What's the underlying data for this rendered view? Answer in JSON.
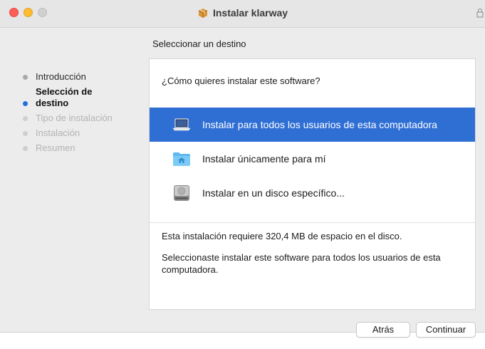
{
  "window": {
    "title": "Instalar klarway"
  },
  "step_header": "Seleccionar un destino",
  "sidebar": {
    "steps": [
      {
        "label": "Introducción",
        "state": "done"
      },
      {
        "label": "Selección de destino",
        "state": "active"
      },
      {
        "label": "Tipo de instalación",
        "state": "future"
      },
      {
        "label": "Instalación",
        "state": "future"
      },
      {
        "label": "Resumen",
        "state": "future"
      }
    ]
  },
  "content": {
    "question": "¿Cómo quieres instalar este software?",
    "options": [
      {
        "label": "Instalar para todos los usuarios de esta computadora",
        "icon": "laptop-icon",
        "selected": true
      },
      {
        "label": "Instalar únicamente para mí",
        "icon": "home-folder-icon",
        "selected": false
      },
      {
        "label": "Instalar en un disco específico...",
        "icon": "disk-icon",
        "selected": false
      }
    ],
    "space_required": "Esta instalación requiere 320,4 MB de espacio en el disco.",
    "selection_note": "Seleccionaste instalar este software para todos los usuarios de esta computadora."
  },
  "buttons": {
    "back": "Atrás",
    "continue": "Continuar"
  },
  "colors": {
    "selection": "#2f6fd4",
    "active_step_dot": "#1f6fe0",
    "close": "#fe5f57",
    "minimize": "#febc2e"
  }
}
